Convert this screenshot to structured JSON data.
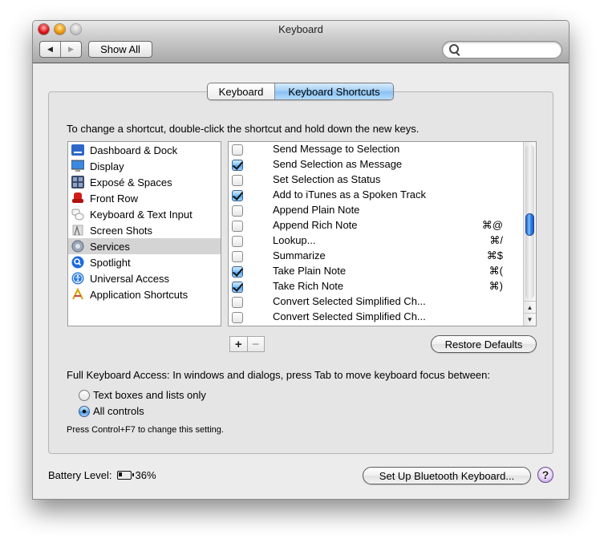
{
  "window": {
    "title": "Keyboard",
    "show_all_label": "Show All",
    "back_icon": "◀",
    "forward_icon": "▶",
    "search": {
      "placeholder": "",
      "value": ""
    }
  },
  "tabs": [
    {
      "label": "Keyboard",
      "selected": false
    },
    {
      "label": "Keyboard Shortcuts",
      "selected": true
    }
  ],
  "instruction": "To change a shortcut, double-click the shortcut and hold down the new keys.",
  "categories": [
    {
      "label": "Dashboard & Dock",
      "icon": "dashboard-dock-icon",
      "selected": false
    },
    {
      "label": "Display",
      "icon": "display-icon",
      "selected": false
    },
    {
      "label": "Exposé & Spaces",
      "icon": "expose-spaces-icon",
      "selected": false
    },
    {
      "label": "Front Row",
      "icon": "front-row-icon",
      "selected": false
    },
    {
      "label": "Keyboard & Text Input",
      "icon": "keyboard-text-input-icon",
      "selected": false
    },
    {
      "label": "Screen Shots",
      "icon": "screen-shots-icon",
      "selected": false
    },
    {
      "label": "Services",
      "icon": "services-gear-icon",
      "selected": true
    },
    {
      "label": "Spotlight",
      "icon": "spotlight-icon",
      "selected": false
    },
    {
      "label": "Universal Access",
      "icon": "universal-access-icon",
      "selected": false
    },
    {
      "label": "Application Shortcuts",
      "icon": "application-shortcuts-icon",
      "selected": false
    }
  ],
  "services": [
    {
      "name": "Send Message to Selection",
      "checked": false,
      "shortcut": ""
    },
    {
      "name": "Send Selection as Message",
      "checked": true,
      "shortcut": ""
    },
    {
      "name": "Set Selection as Status",
      "checked": false,
      "shortcut": ""
    },
    {
      "name": "Add to iTunes as a Spoken Track",
      "checked": true,
      "shortcut": ""
    },
    {
      "name": "Append Plain Note",
      "checked": false,
      "shortcut": ""
    },
    {
      "name": "Append Rich Note",
      "checked": false,
      "shortcut": "⌘@"
    },
    {
      "name": "Lookup...",
      "checked": false,
      "shortcut": "⌘/"
    },
    {
      "name": "Summarize",
      "checked": false,
      "shortcut": "⌘$"
    },
    {
      "name": "Take Plain Note",
      "checked": true,
      "shortcut": "⌘("
    },
    {
      "name": "Take Rich Note",
      "checked": true,
      "shortcut": "⌘)"
    },
    {
      "name": "Convert Selected Simplified Ch...",
      "checked": false,
      "shortcut": ""
    },
    {
      "name": "Convert Selected Simplified Ch...",
      "checked": false,
      "shortcut": ""
    }
  ],
  "scroll": {
    "up_icon": "▲",
    "down_icon": "▼",
    "position_fraction": 0.45
  },
  "add_label": "+",
  "remove_label": "−",
  "restore_defaults_label": "Restore Defaults",
  "full_keyboard_access": {
    "label": "Full Keyboard Access: In windows and dialogs, press Tab to move keyboard focus between:",
    "options": [
      {
        "label": "Text boxes and lists only",
        "selected": false
      },
      {
        "label": "All controls",
        "selected": true
      }
    ],
    "hint": "Press Control+F7 to change this setting."
  },
  "battery": {
    "label": "Battery Level:",
    "value": "36%"
  },
  "bluetooth_button_label": "Set Up Bluetooth Keyboard...",
  "help_label": "?"
}
